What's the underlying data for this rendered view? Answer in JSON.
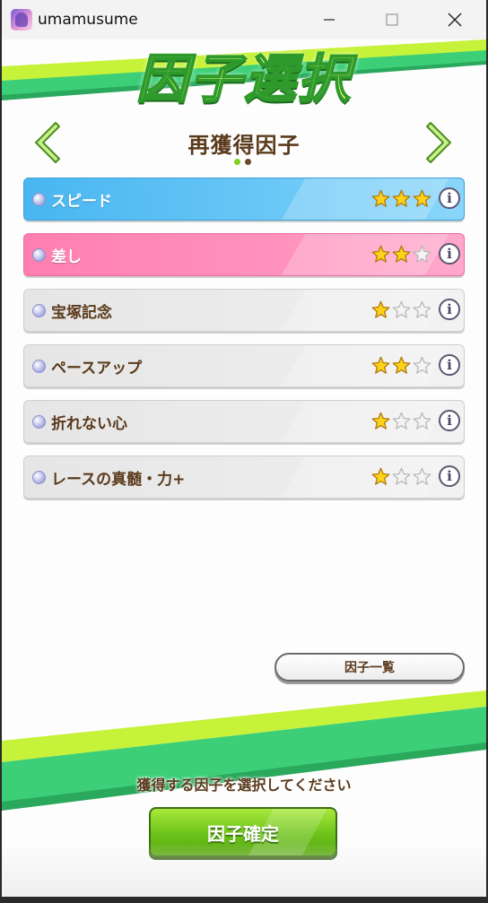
{
  "window": {
    "title": "umamusume",
    "icon": "app-icon",
    "controls": [
      "minimize-icon",
      "maximize-icon",
      "close-icon"
    ]
  },
  "header": {
    "title": "因子選択",
    "subtitle": "再獲得因子",
    "page_count": 2,
    "current_page": 1
  },
  "factors": [
    {
      "label": "スピード",
      "color": "blue",
      "stars": 3
    },
    {
      "label": "差し",
      "color": "pink",
      "stars": 2
    },
    {
      "label": "宝塚記念",
      "color": "gray",
      "stars": 1
    },
    {
      "label": "ペースアップ",
      "color": "gray",
      "stars": 2
    },
    {
      "label": "折れない心",
      "color": "gray",
      "stars": 1
    },
    {
      "label": "レースの真髄・力+",
      "color": "gray",
      "stars": 1
    }
  ],
  "info_label": "i",
  "list_button": {
    "label": "因子一覧"
  },
  "footer": {
    "prompt": "獲得する因子を選択してください",
    "confirm_label": "因子確定"
  },
  "colors": {
    "accent_green": "#7fd11b",
    "speed_blue": "#48b6f0",
    "strategy_pink": "#ff7fb0",
    "text_brown": "#5a3a1c"
  }
}
